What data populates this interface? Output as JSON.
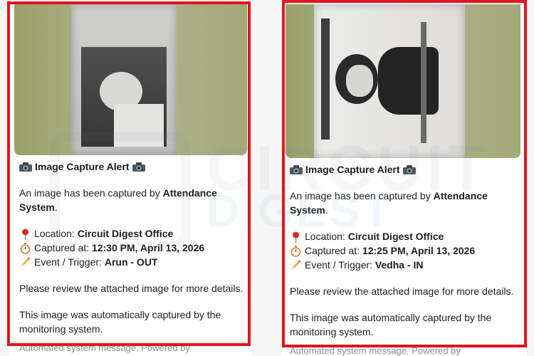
{
  "watermark": {
    "line1": "CIRCUIT",
    "line2": "DIGEST"
  },
  "colors": {
    "frame": "#e4141b",
    "text": "#1d1d1d",
    "footer": "#8c8c8c"
  },
  "cards": [
    {
      "title": "Image Capture Alert",
      "intro_prefix": "An image has been captured by ",
      "intro_system": "Attendance System",
      "intro_suffix": ".",
      "location_label": "Location: ",
      "location_value": "Circuit Digest Office",
      "captured_label": "Captured at: ",
      "captured_value": "12:30 PM, April 13, 2026",
      "event_label": "Event / Trigger: ",
      "event_value": "Arun - OUT",
      "review": "Please review the attached image for more details.",
      "auto": "This image was automatically captured by the monitoring system.",
      "footer": "Automated system message. Powered by"
    },
    {
      "title": "Image Capture Alert",
      "intro_prefix": "An image has been captured by ",
      "intro_system": "Attendance System",
      "intro_suffix": ".",
      "location_label": "Location: ",
      "location_value": "Circuit Digest Office",
      "captured_label": "Captured at: ",
      "captured_value": "12:25 PM, April 13, 2026",
      "event_label": "Event / Trigger: ",
      "event_value": "Vedha - IN",
      "review": "Please review the attached image for more details.",
      "auto": "This image was automatically captured by the monitoring system.",
      "footer": "Automated system message. Powered by"
    }
  ],
  "icons": {
    "camera": "camera-icon",
    "pin": "map-pin-icon",
    "stopwatch": "stopwatch-icon",
    "pencil": "pencil-icon"
  }
}
